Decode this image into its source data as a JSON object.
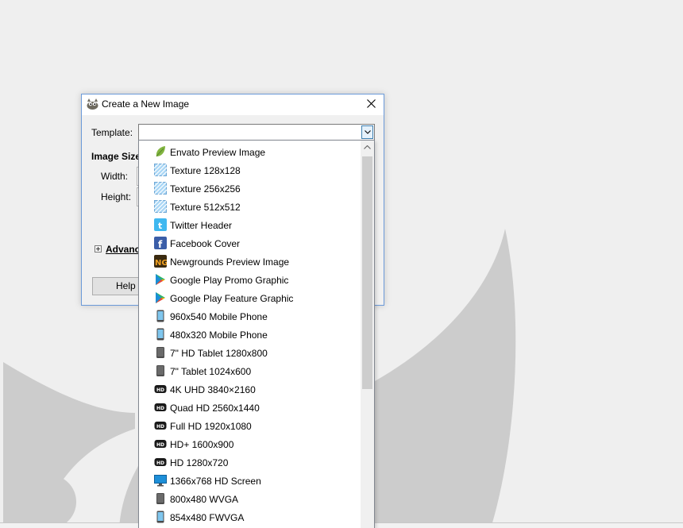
{
  "dialog": {
    "title": "Create a New Image",
    "template_label": "Template:",
    "template_value": "",
    "image_size_label": "Image Size",
    "width_label": "Width:",
    "height_label": "Height:",
    "advanced_label": "Advanc",
    "help_label": "Help",
    "accent_color": "#6b9ad9"
  },
  "dropdown": {
    "items": [
      {
        "label": "Envato Preview Image",
        "icon": "leaf-icon"
      },
      {
        "label": "Texture 128x128",
        "icon": "texture-icon"
      },
      {
        "label": "Texture 256x256",
        "icon": "texture-icon"
      },
      {
        "label": "Texture 512x512",
        "icon": "texture-icon"
      },
      {
        "label": "Twitter Header",
        "icon": "twitter-icon"
      },
      {
        "label": "Facebook Cover",
        "icon": "facebook-icon"
      },
      {
        "label": "Newgrounds Preview Image",
        "icon": "newgrounds-icon"
      },
      {
        "label": "Google Play Promo Graphic",
        "icon": "google-play-icon"
      },
      {
        "label": "Google Play Feature Graphic",
        "icon": "google-play-icon"
      },
      {
        "label": "960x540 Mobile Phone",
        "icon": "phone-icon"
      },
      {
        "label": "480x320 Mobile Phone",
        "icon": "phone-icon"
      },
      {
        "label": "7\" HD Tablet 1280x800",
        "icon": "tablet-icon"
      },
      {
        "label": "7\" Tablet 1024x600",
        "icon": "tablet-icon"
      },
      {
        "label": "4K UHD 3840×2160",
        "icon": "hd-icon"
      },
      {
        "label": "Quad HD 2560x1440",
        "icon": "hd-icon"
      },
      {
        "label": "Full HD 1920x1080",
        "icon": "hd-icon"
      },
      {
        "label": "HD+ 1600x900",
        "icon": "hd-icon"
      },
      {
        "label": "HD 1280x720",
        "icon": "hd-icon"
      },
      {
        "label": "1366x768 HD Screen",
        "icon": "monitor-icon"
      },
      {
        "label": "800x480 WVGA",
        "icon": "tablet-icon"
      },
      {
        "label": "854x480 FWVGA",
        "icon": "phone-icon"
      }
    ]
  }
}
